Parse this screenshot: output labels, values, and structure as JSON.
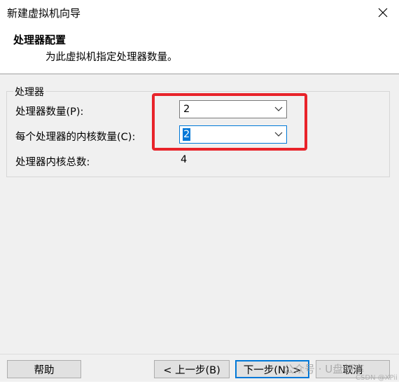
{
  "window": {
    "title": "新建虚拟机向导",
    "close_icon": "close-icon"
  },
  "header": {
    "title": "处理器配置",
    "subtitle": "为此虚拟机指定处理器数量。"
  },
  "processor_group": {
    "legend": "处理器",
    "processor_count_label": "处理器数量(P):",
    "processor_count_value": "2",
    "cores_per_processor_label": "每个处理器的内核数量(C):",
    "cores_per_processor_value": "2",
    "total_cores_label": "处理器内核总数:",
    "total_cores_value": "4"
  },
  "buttons": {
    "help": "帮助",
    "back": "< 上一步(B)",
    "next": "下一步(N) >",
    "cancel": "取消"
  },
  "watermark": {
    "main": "公众号 · U盘频率",
    "sub": "CSDN @XPii"
  },
  "colors": {
    "highlight_box": "#e8232a",
    "focus_accent": "#0078d7"
  }
}
